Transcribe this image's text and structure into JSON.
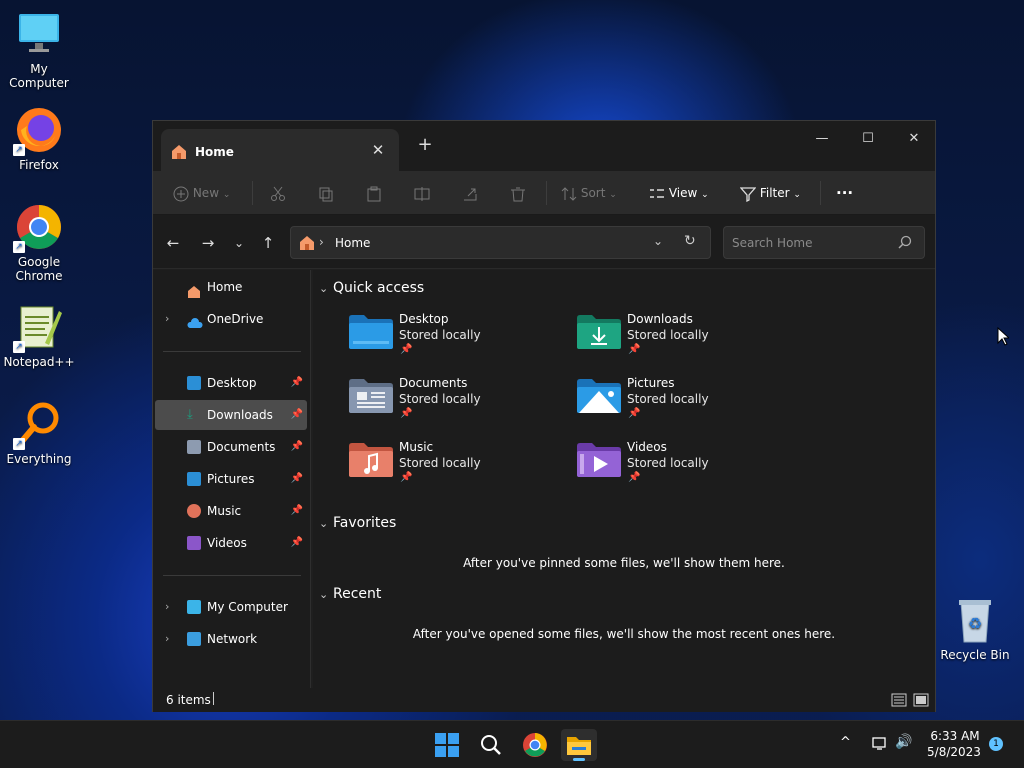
{
  "desktop": {
    "icons": [
      {
        "label": "My Computer",
        "icon": "monitor-icon"
      },
      {
        "label": "Firefox",
        "icon": "firefox-icon"
      },
      {
        "label": "Google Chrome",
        "icon": "chrome-icon"
      },
      {
        "label": "Notepad++",
        "icon": "notepadpp-icon"
      },
      {
        "label": "Everything",
        "icon": "everything-icon"
      },
      {
        "label": "Recycle Bin",
        "icon": "recycle-bin-icon"
      }
    ]
  },
  "window": {
    "tab_title": "Home",
    "new_tab": "+",
    "toolbar": {
      "new_label": "New",
      "sort_label": "Sort",
      "view_label": "View",
      "filter_label": "Filter",
      "more": "..."
    },
    "address": {
      "crumb": "Home"
    },
    "search": {
      "placeholder": "Search Home"
    },
    "sidebar": {
      "items": [
        {
          "label": "Home",
          "icon": "home-icon"
        },
        {
          "label": "OneDrive",
          "icon": "cloud-icon"
        },
        {
          "label": "Desktop",
          "icon": "desktop-icon",
          "pinned": true
        },
        {
          "label": "Downloads",
          "icon": "download-icon",
          "pinned": true,
          "selected": true
        },
        {
          "label": "Documents",
          "icon": "document-icon",
          "pinned": true
        },
        {
          "label": "Pictures",
          "icon": "pictures-icon",
          "pinned": true
        },
        {
          "label": "Music",
          "icon": "music-icon",
          "pinned": true
        },
        {
          "label": "Videos",
          "icon": "video-icon",
          "pinned": true
        },
        {
          "label": "My Computer",
          "icon": "monitor-icon"
        },
        {
          "label": "Network",
          "icon": "network-icon"
        }
      ]
    },
    "quick_access": {
      "title": "Quick access",
      "items": [
        {
          "name": "Desktop",
          "status": "Stored locally",
          "color": "#2b8fd6"
        },
        {
          "name": "Downloads",
          "status": "Stored locally",
          "color": "#1c9d7e"
        },
        {
          "name": "Documents",
          "status": "Stored locally",
          "color": "#7e8ea8"
        },
        {
          "name": "Pictures",
          "status": "Stored locally",
          "color": "#2b8fd6"
        },
        {
          "name": "Music",
          "status": "Stored locally",
          "color": "#e0725a"
        },
        {
          "name": "Videos",
          "status": "Stored locally",
          "color": "#8b56c9"
        }
      ]
    },
    "favorites": {
      "title": "Favorites",
      "empty_text": "After you've pinned some files, we'll show them here."
    },
    "recent": {
      "title": "Recent",
      "empty_text": "After you've opened some files, we'll show the most recent ones here."
    },
    "status": {
      "items_count": "6 items"
    }
  },
  "taskbar": {
    "time": "6:33 AM",
    "date": "5/8/2023",
    "notification_count": "1"
  }
}
